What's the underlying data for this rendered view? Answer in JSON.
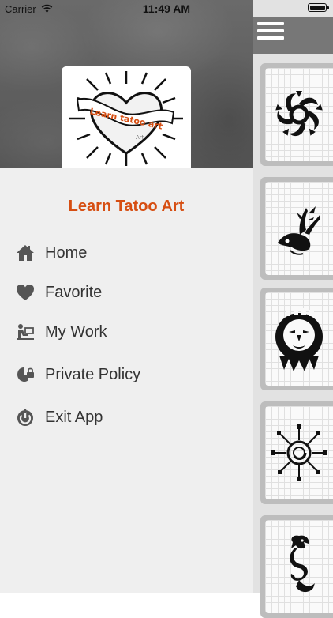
{
  "status_bar": {
    "carrier": "Carrier",
    "time": "11:49 AM"
  },
  "drawer": {
    "logo_text": "Learn tatoo art",
    "logo_subtext": "Art",
    "app_title": "Learn Tatoo Art",
    "menu": [
      {
        "label": "Home",
        "icon": "home-icon"
      },
      {
        "label": "Favorite",
        "icon": "heart-icon"
      },
      {
        "label": "My Work",
        "icon": "desk-user-icon"
      },
      {
        "label": "Private Policy",
        "icon": "shield-lock-icon"
      },
      {
        "label": "Exit App",
        "icon": "power-icon"
      }
    ]
  },
  "colors": {
    "accent": "#d64e12",
    "drawer_bg": "#efefef",
    "header_bg": "#5c5c5c"
  },
  "gallery": [
    {
      "icon": "tribal-sun-tattoo"
    },
    {
      "icon": "tribal-deer-tattoo"
    },
    {
      "icon": "tribal-mask-tattoo"
    },
    {
      "icon": "tribal-swirl-sun-tattoo"
    },
    {
      "icon": "tribal-dragon-tattoo"
    }
  ]
}
